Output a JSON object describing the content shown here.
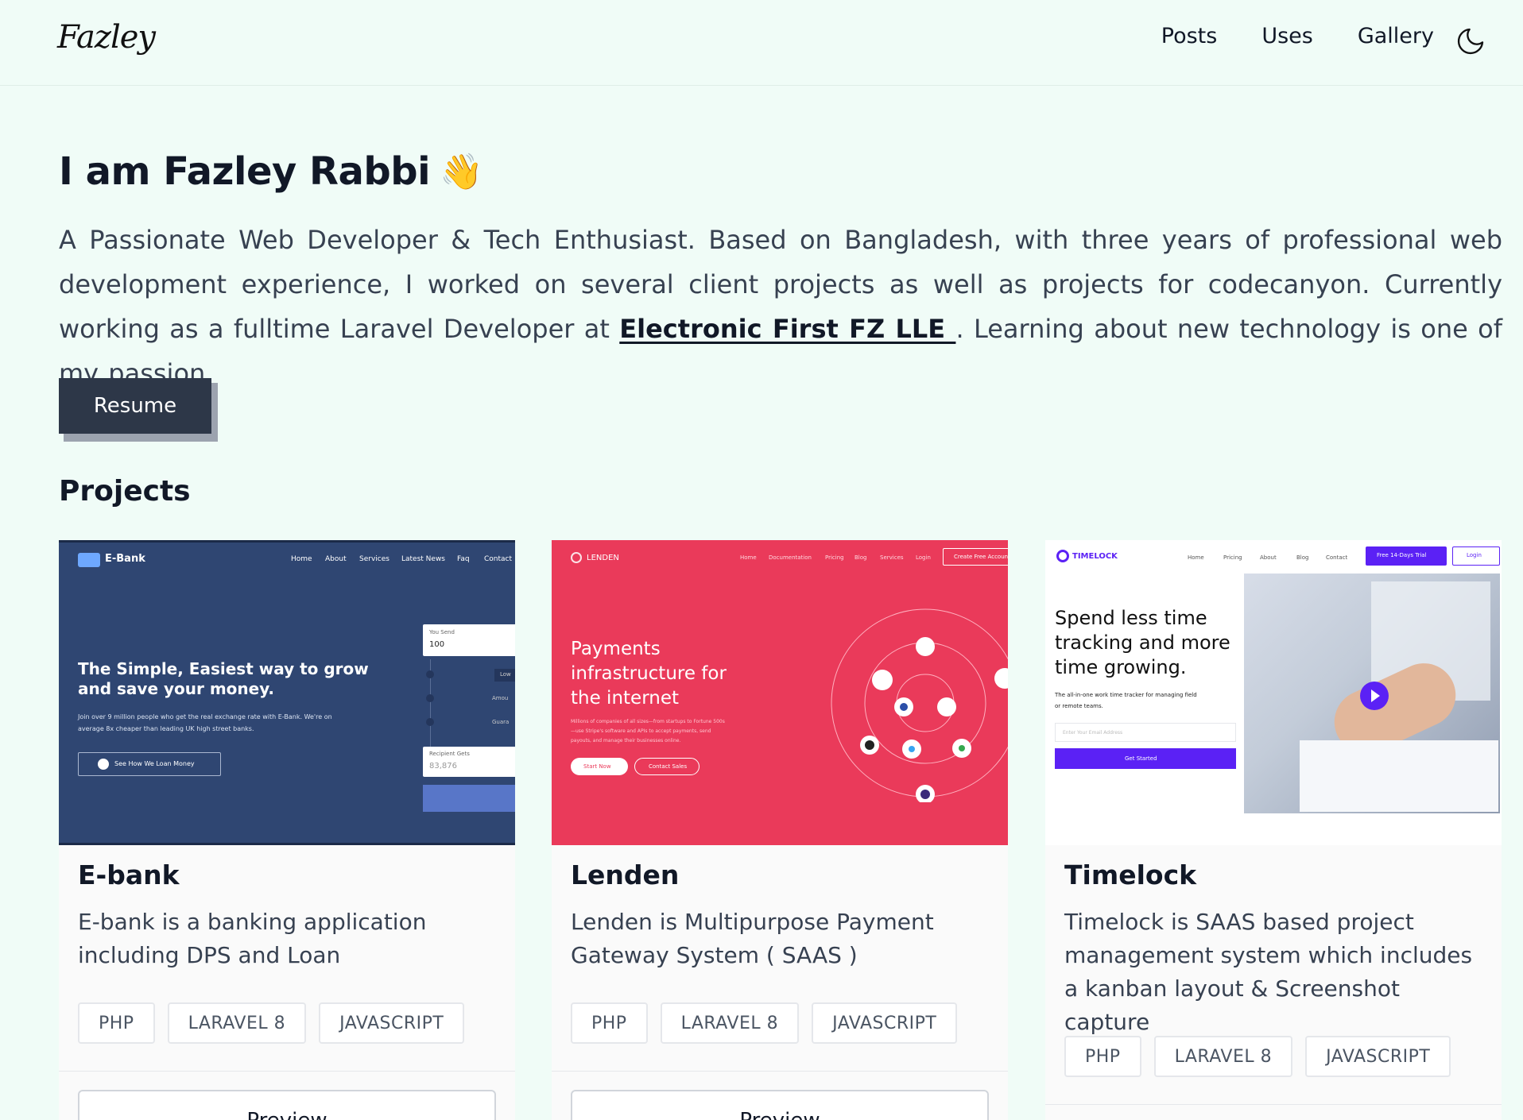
{
  "header": {
    "logo": "Fazley",
    "nav": [
      "Posts",
      "Uses",
      "Gallery"
    ],
    "theme_toggle_icon": "moon-icon"
  },
  "intro": {
    "title": "I am Fazley Rabbi",
    "wave_emoji": "👋",
    "bio_before": "A Passionate Web Developer & Tech Enthusiast. Based on Bangladesh, with three years of professional web development experience, I worked on several client projects as well as projects for codecanyon. Currently working as a fulltime Laravel Developer at ",
    "company": "Electronic First FZ LLE ",
    "bio_after": ". Learning about new technology is one of my passion.",
    "resume_label": "Resume"
  },
  "projects": {
    "heading": "Projects",
    "preview_label": "Preview",
    "items": [
      {
        "name": "E-bank",
        "description": "E-bank is a banking application including DPS and Loan",
        "tags": [
          "PHP",
          "LARAVEL 8",
          "JAVASCRIPT"
        ],
        "screenshot": {
          "brand": "E-Bank",
          "nav": [
            "Home",
            "About",
            "Services",
            "Latest News",
            "Faq",
            "Contact"
          ],
          "headline_1": "The Simple, Easiest way to grow",
          "headline_2": "and save your money.",
          "sub_1": "Join over 9 million people who get the real exchange rate with E-Bank. We're on",
          "sub_2": "average 8x cheaper than leading UK high street banks.",
          "cta": "See How We Loan Money",
          "you_send_label": "You Send",
          "you_send_value": "100",
          "recipient_label": "Recipient Gets",
          "recipient_value": "83,876",
          "side_1": "Low",
          "side_2": "Amou",
          "side_3": "Guara"
        }
      },
      {
        "name": "Lenden",
        "description": "Lenden is Multipurpose Payment Gateway System ( SAAS )",
        "tags": [
          "PHP",
          "LARAVEL 8",
          "JAVASCRIPT"
        ],
        "screenshot": {
          "brand": "LENDEN",
          "nav": [
            "Home",
            "Documentation",
            "Pricing",
            "Blog",
            "Services",
            "Login"
          ],
          "cta_top": "Create Free Account",
          "headline_1": "Payments",
          "headline_2": "infrastructure for",
          "headline_3": "the internet",
          "sub_1": "Millions of companies of all sizes—from startups to Fortune 500s",
          "sub_2": "—use Stripe's software and APIs to accept payments, send",
          "sub_3": "payouts, and manage their businesses online.",
          "btn_1": "Start Now",
          "btn_2": "Contact Sales"
        }
      },
      {
        "name": "Timelock",
        "description": "Timelock is SAAS based project management system which includes a kanban layout & Screenshot capture",
        "tags": [
          "PHP",
          "LARAVEL 8",
          "JAVASCRIPT"
        ],
        "screenshot": {
          "brand": "TIMELOCK",
          "nav": [
            "Home",
            "Pricing",
            "About",
            "Blog",
            "Contact"
          ],
          "trial": "Free 14-Days Trial",
          "login": "Login",
          "headline_1": "Spend less time",
          "headline_2": "tracking and more",
          "headline_3": "time growing.",
          "sub_1": "The all-in-one work time tracker for managing field",
          "sub_2": "or remote teams.",
          "input_placeholder": "Enter Your Email Address",
          "cta": "Get Started"
        }
      }
    ]
  },
  "colors": {
    "background": "#f0fcf7",
    "ebank_bg": "#2f4672",
    "lenden_bg": "#ea3a5a",
    "timelock_accent": "#5b21f5",
    "dark_button": "#2d3748"
  }
}
